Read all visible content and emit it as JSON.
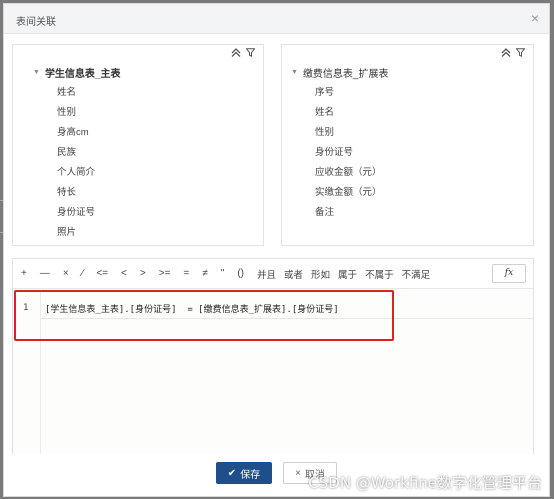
{
  "dialog": {
    "title": "表间关联",
    "close_glyph": "×"
  },
  "left_panel": {
    "table_name": "学生信息表_主表",
    "fields": [
      "姓名",
      "性别",
      "身高cm",
      "民族",
      "个人简介",
      "特长",
      "身份证号",
      "照片"
    ]
  },
  "right_panel": {
    "table_name": "缴费信息表_扩展表",
    "fields": [
      "序号",
      "姓名",
      "性别",
      "身份证号",
      "应收金额（元）",
      "实缴金额（元）",
      "备注"
    ]
  },
  "operators": [
    {
      "label": "+",
      "kind": "sym"
    },
    {
      "label": "—",
      "kind": "sym"
    },
    {
      "label": "×",
      "kind": "sym"
    },
    {
      "label": "∕",
      "kind": "sym"
    },
    {
      "label": "<=",
      "kind": "sym"
    },
    {
      "label": "<",
      "kind": "sym"
    },
    {
      "label": ">",
      "kind": "sym"
    },
    {
      "label": ">=",
      "kind": "sym"
    },
    {
      "label": "=",
      "kind": "sym"
    },
    {
      "label": "≠",
      "kind": "sym"
    },
    {
      "label": "\"",
      "kind": "sym"
    },
    {
      "label": "()",
      "kind": "sym"
    },
    {
      "label": "并且",
      "kind": "text"
    },
    {
      "label": "或者",
      "kind": "text"
    },
    {
      "label": "形如",
      "kind": "text"
    },
    {
      "label": "属于",
      "kind": "text"
    },
    {
      "label": "不属于",
      "kind": "text"
    },
    {
      "label": "不满足",
      "kind": "text"
    }
  ],
  "fx_label": "fx",
  "editor": {
    "line_number": "1",
    "expression": "[学生信息表_主表].[身份证号]  = [缴费信息表_扩展表].[身份证号]"
  },
  "buttons": {
    "save_label": "保存",
    "cancel_label": "取消"
  },
  "icons": {
    "collapse": "double-chevron-up-icon",
    "filter": "filter-icon",
    "save": "check-icon",
    "cancel": "close-icon"
  },
  "watermark": "CSDN @Workfine数字化管理平台"
}
